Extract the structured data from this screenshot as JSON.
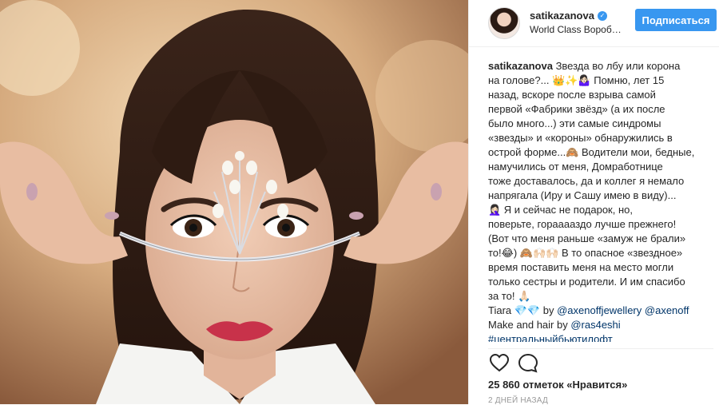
{
  "post": {
    "username": "satikazanova",
    "location": "World Class Вороб…",
    "follow_label": "Подписаться",
    "verified_mark": "✓"
  },
  "caption": {
    "username": "satikazanova",
    "lines": [
      "Звезда во лбу или корона",
      "на голове?... 👑✨🤷🏻‍♀️ Помню, лет 15",
      "назад, вскоре после взрыва самой",
      "первой «Фабрики звёзд» (а их после",
      "было много...) эти самые синдромы",
      "«звезды» и «короны» обнаружились в",
      "острой форме...🙈 Водители мои, бедные,",
      "намучились от меня, Домработнице",
      "тоже доставалось, да и коллег я немало",
      "напрягала (Иру и Сашу имею в виду)...",
      "🤦🏻‍♀️ Я и сейчас не подарок, но,",
      "поверьте, горааааздо лучше прежнего!",
      "(Вот что меня раньше «замуж не брали»",
      "то!😂) 🙈🙌🏻🙌🏻 В то опасное «звездное»",
      "время поставить меня на место могли",
      "только сестры и родители. И им спасибо",
      "за то! 🙏🏻"
    ],
    "tiara_prefix": "Tiara 💎💎 by ",
    "tiara_link1": "@axenoffjewellery",
    "tiara_link2": "@axenoff",
    "makeup_prefix": "Make and hair by ",
    "makeup_link": "@ras4eshi",
    "hashtag": "#центральныйбьютилофт"
  },
  "actions": {
    "like_icon": "heart-outline-icon",
    "comment_icon": "comment-bubble-icon"
  },
  "stats": {
    "likes": "25 860 отметок «Нравится»",
    "time": "2 ДНЕЙ НАЗАД"
  },
  "colors": {
    "accent": "#3897f0",
    "link": "#003569",
    "text": "#262626",
    "muted": "#999999"
  }
}
